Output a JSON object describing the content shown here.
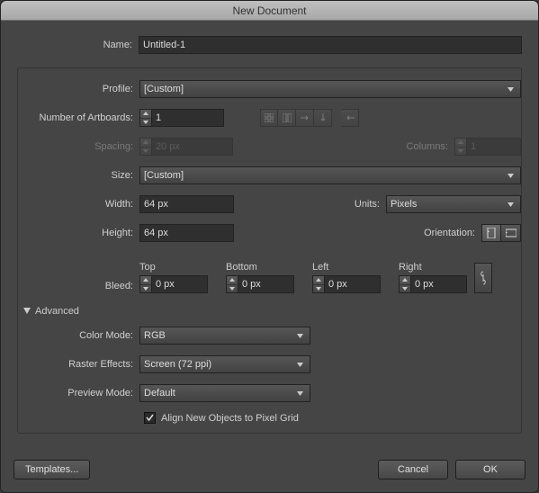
{
  "title": "New Document",
  "name_label": "Name:",
  "name_value": "Untitled-1",
  "profile_label": "Profile:",
  "profile_value": "[Custom]",
  "artboards_label": "Number of Artboards:",
  "artboards_value": "1",
  "spacing_label": "Spacing:",
  "spacing_value": "20 px",
  "columns_label": "Columns:",
  "columns_value": "1",
  "size_label": "Size:",
  "size_value": "[Custom]",
  "width_label": "Width:",
  "width_value": "64 px",
  "units_label": "Units:",
  "units_value": "Pixels",
  "height_label": "Height:",
  "height_value": "64 px",
  "orientation_label": "Orientation:",
  "bleed_label": "Bleed:",
  "bleed": {
    "top_label": "Top",
    "top_value": "0 px",
    "bottom_label": "Bottom",
    "bottom_value": "0 px",
    "left_label": "Left",
    "left_value": "0 px",
    "right_label": "Right",
    "right_value": "0 px"
  },
  "advanced_label": "Advanced",
  "color_mode_label": "Color Mode:",
  "color_mode_value": "RGB",
  "raster_label": "Raster Effects:",
  "raster_value": "Screen (72 ppi)",
  "preview_label": "Preview Mode:",
  "preview_value": "Default",
  "align_label": "Align New Objects to Pixel Grid",
  "align_checked": true,
  "templates_label": "Templates...",
  "cancel_label": "Cancel",
  "ok_label": "OK"
}
